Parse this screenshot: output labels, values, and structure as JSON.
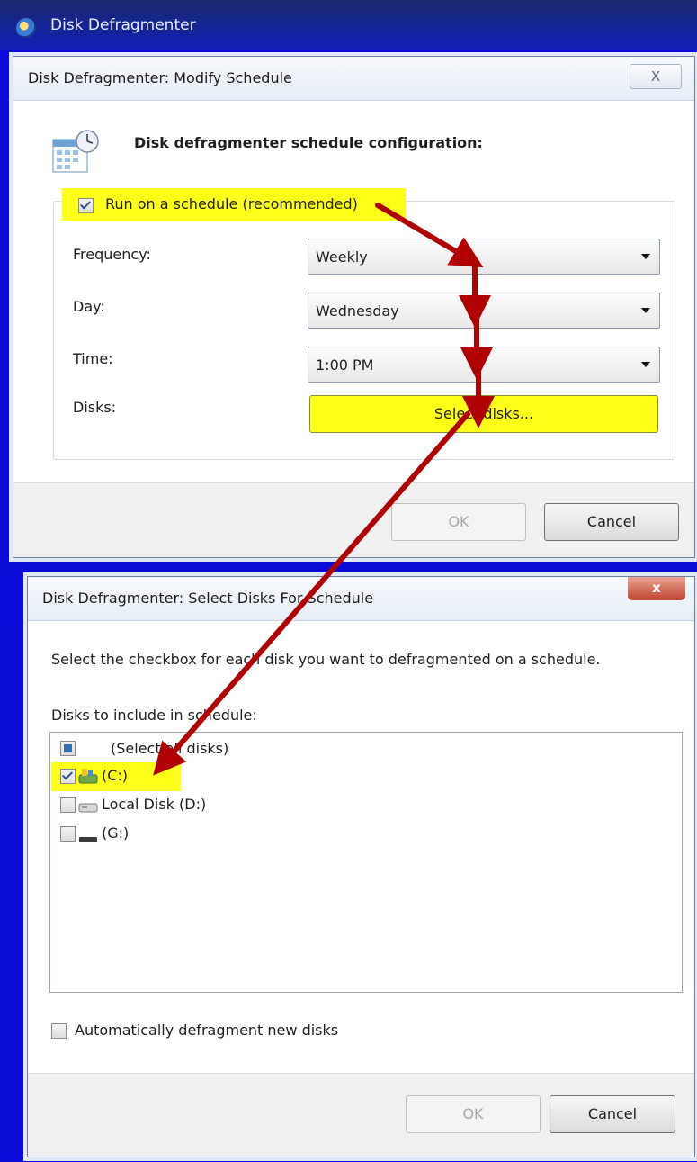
{
  "parent_window": {
    "title": "Disk Defragmenter"
  },
  "modify_dialog": {
    "title": "Disk Defragmenter: Modify Schedule",
    "close_glyph": "X",
    "heading": "Disk defragmenter schedule configuration:",
    "run_on_schedule": {
      "label": "Run on a schedule (recommended)",
      "checked": true
    },
    "frequency": {
      "label": "Frequency:",
      "value": "Weekly"
    },
    "day": {
      "label": "Day:",
      "value": "Wednesday"
    },
    "time": {
      "label": "Time:",
      "value": "1:00 PM"
    },
    "disks": {
      "label": "Disks:",
      "button": "Select disks..."
    },
    "ok_label": "OK",
    "cancel_label": "Cancel"
  },
  "select_dialog": {
    "title": "Disk Defragmenter: Select Disks For Schedule",
    "close_glyph": "x",
    "instruction": "Select the checkbox for each disk you want to defragmented on a schedule.",
    "list_label": "Disks to include in schedule:",
    "disks": [
      {
        "label": "(Select all disks)",
        "state": "partial",
        "icon": "select-all-icon"
      },
      {
        "label": "(C:)",
        "state": "checked",
        "icon": "system-drive-icon"
      },
      {
        "label": "Local Disk (D:)",
        "state": "unchecked",
        "icon": "hard-drive-icon"
      },
      {
        "label": "(G:)",
        "state": "unchecked",
        "icon": "removable-drive-icon"
      }
    ],
    "auto_defrag": {
      "label": "Automatically defragment new disks",
      "checked": false
    },
    "ok_label": "OK",
    "cancel_label": "Cancel"
  },
  "colors": {
    "background": "#0a0ad8",
    "highlight": "#ffff1a",
    "annotation_arrow": "#b00000"
  }
}
